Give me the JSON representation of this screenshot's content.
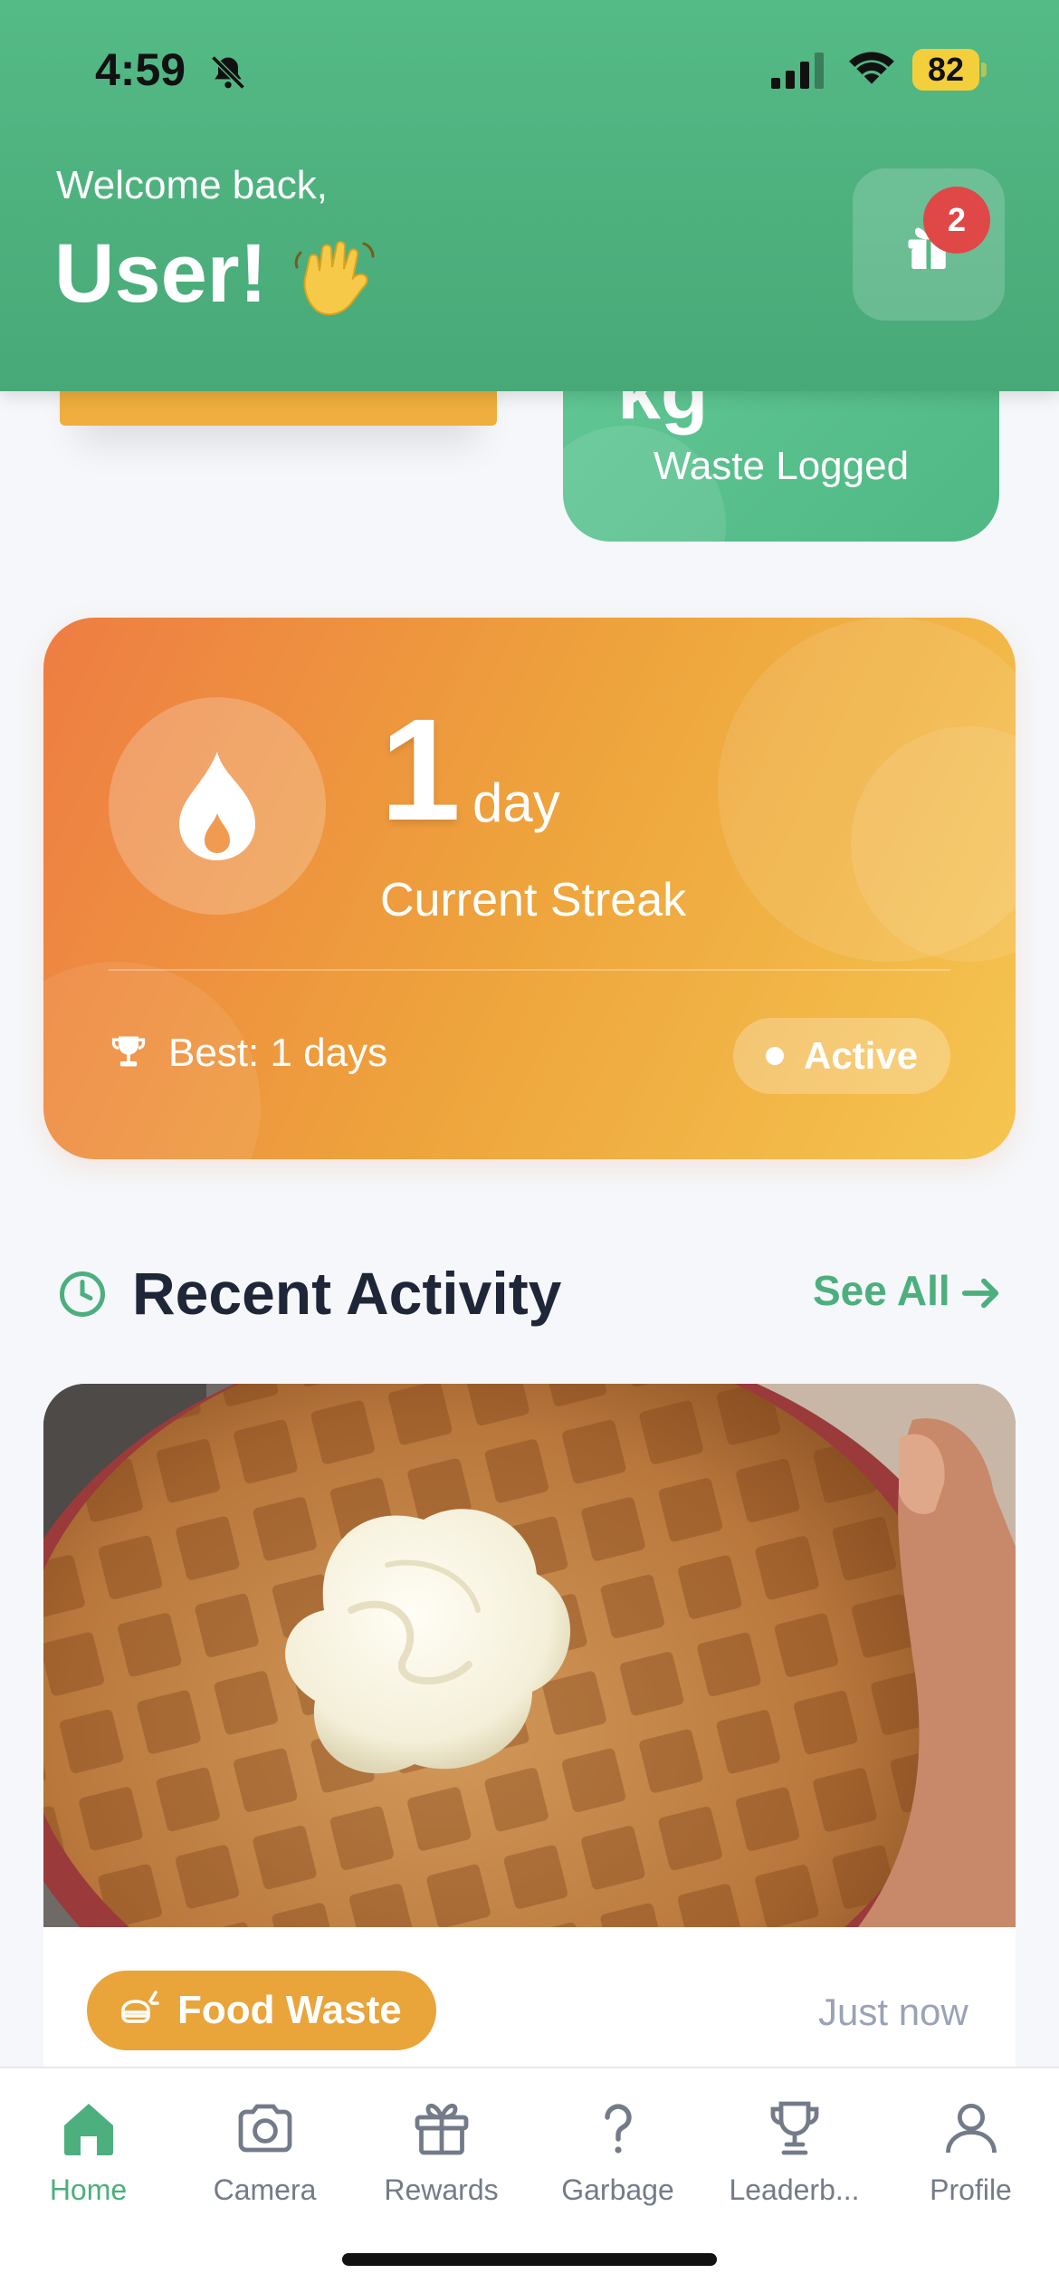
{
  "status_bar": {
    "time": "4:59",
    "battery": "82"
  },
  "header": {
    "welcome": "Welcome back,",
    "username": "User!",
    "wave_emoji": "waving-hand",
    "gift_badge_count": "2"
  },
  "stats": {
    "waste_partial_value": "kg",
    "waste_label": "Waste Logged"
  },
  "streak": {
    "value": "1",
    "unit": "day",
    "label": "Current Streak",
    "best": "Best: 1 days",
    "status": "Active"
  },
  "recent_activity": {
    "title": "Recent Activity",
    "see_all": "See All",
    "items": [
      {
        "category": "Food Waste",
        "time": "Just now",
        "photo": "waffle-with-whipped-cream"
      }
    ]
  },
  "tabs": [
    {
      "label": "Home",
      "icon": "home-icon",
      "active": true
    },
    {
      "label": "Camera",
      "icon": "camera-icon",
      "active": false
    },
    {
      "label": "Rewards",
      "icon": "gift-icon",
      "active": false
    },
    {
      "label": "Garbage",
      "icon": "question-icon",
      "active": false
    },
    {
      "label": "Leaderb...",
      "icon": "trophy-icon",
      "active": false
    },
    {
      "label": "Profile",
      "icon": "person-icon",
      "active": false
    }
  ],
  "colors": {
    "primary_green": "#4caf7d",
    "header_green": "#54ba86",
    "streak_orange": "#ee7d43",
    "streak_yellow": "#f5c550",
    "badge_red": "#e04848",
    "food_pill": "#e9a43a"
  }
}
